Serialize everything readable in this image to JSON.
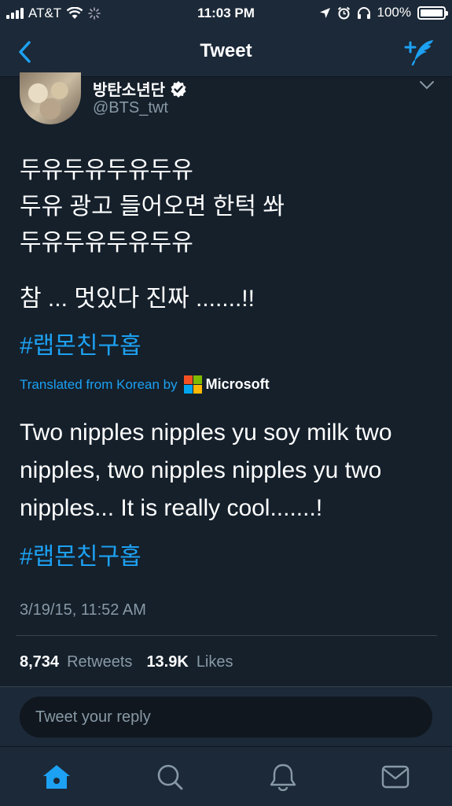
{
  "status_bar": {
    "carrier": "AT&T",
    "time": "11:03 PM",
    "battery": "100%"
  },
  "nav": {
    "title": "Tweet",
    "back_icon": "chevron-left-icon",
    "compose_icon": "compose-tweet-icon"
  },
  "tweet": {
    "display_name": "방탄소년단",
    "handle": "@BTS_twt",
    "lines": [
      "두유두유두유두유",
      "두유 광고 들어오면 한턱 쏴",
      "두유두유두유두유"
    ],
    "line4": "참 ... 멋있다 진짜 .......!!",
    "hashtag": "#랩몬친구홉",
    "translated_label": "Translated from Korean by",
    "translator": "Microsoft",
    "translation": "Two nipples nipples yu soy milk two nipples, two nipples nipples yu two nipples... It is really cool.......!",
    "translation_hashtag": "#랩몬친구홉",
    "timestamp": "3/19/15, 11:52 AM",
    "retweets_count": "8,734",
    "retweets_label": "Retweets",
    "likes_count": "13.9K",
    "likes_label": "Likes"
  },
  "reply": {
    "placeholder": "Tweet your reply"
  },
  "tabs": [
    "home-icon",
    "search-icon",
    "notifications-icon",
    "messages-icon"
  ],
  "colors": {
    "background": "#15202b",
    "bar": "#1c2938",
    "accent": "#1da1f2",
    "muted": "#8899a6"
  }
}
